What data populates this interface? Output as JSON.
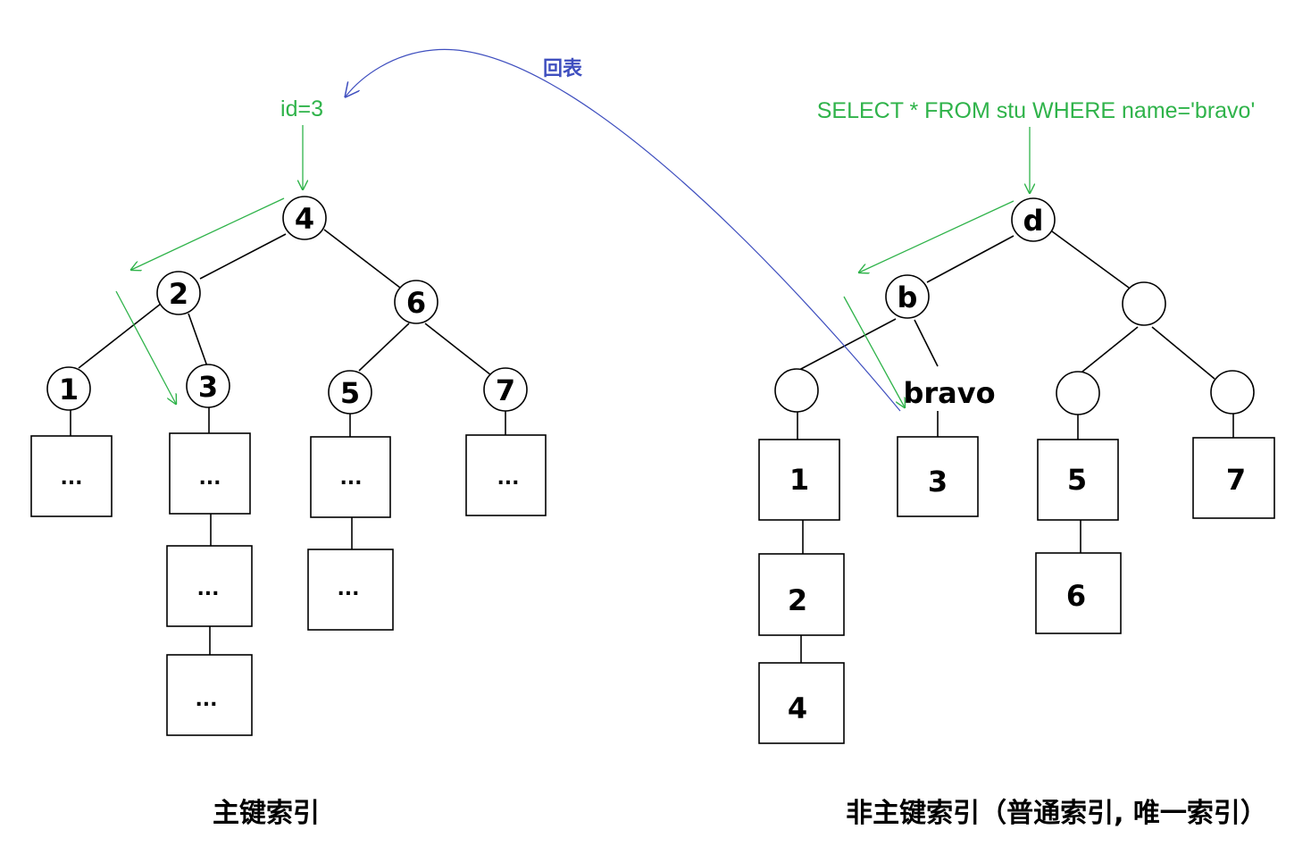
{
  "query_text": "SELECT * FROM stu WHERE name='bravo'",
  "lookup_text": "id=3",
  "back_to_table_text": "回表",
  "primary_caption": "主键索引",
  "secondary_caption": "非主键索引（普通索引, 唯一索引）",
  "primary_tree": {
    "root": "4",
    "level2": [
      "2",
      "6"
    ],
    "level3": [
      "1",
      "3",
      "5",
      "7"
    ],
    "leaves": [
      "...",
      "...",
      "...",
      "...",
      "...",
      "...",
      "..."
    ]
  },
  "secondary_tree": {
    "root": "d",
    "level2": [
      "b",
      ""
    ],
    "level3": [
      "",
      "bravo",
      "",
      ""
    ],
    "leaves": [
      "1",
      "2",
      "4",
      "3",
      "5",
      "6",
      "7"
    ]
  },
  "colors": {
    "green": "#2fb34a",
    "blue": "#3f4fbf",
    "ink": "#000000"
  }
}
